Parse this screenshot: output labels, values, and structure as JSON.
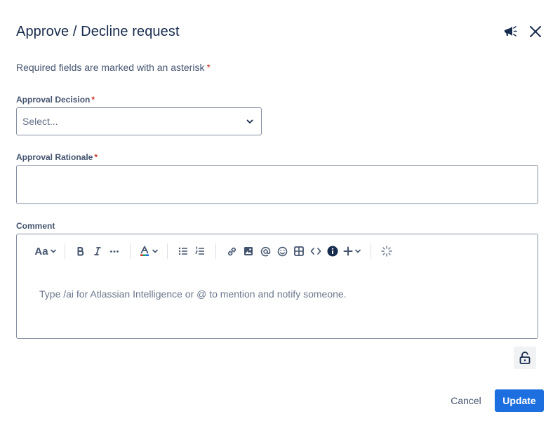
{
  "dialog": {
    "title": "Approve / Decline request",
    "required_note": "Required fields are marked with an asterisk",
    "asterisk": "*"
  },
  "fields": {
    "approval_decision": {
      "label": "Approval Decision",
      "placeholder": "Select..."
    },
    "approval_rationale": {
      "label": "Approval Rationale",
      "value": ""
    },
    "comment": {
      "label": "Comment",
      "placeholder": "Type /ai for Atlassian Intelligence or @ to mention and notify someone."
    }
  },
  "toolbar": {
    "text_style_label": "Aa",
    "items": [
      "text-style",
      "bold",
      "italic",
      "more-formatting",
      "text-color",
      "bullet-list",
      "numbered-list",
      "link",
      "image",
      "mention",
      "emoji",
      "table",
      "code",
      "info-panel",
      "insert",
      "ai"
    ]
  },
  "buttons": {
    "cancel": "Cancel",
    "update": "Update"
  },
  "colors": {
    "primary": "#1d6fe0",
    "required": "#c9372c",
    "text": "#172b4d",
    "subtle_text": "#44546f",
    "border": "#8590a2"
  }
}
